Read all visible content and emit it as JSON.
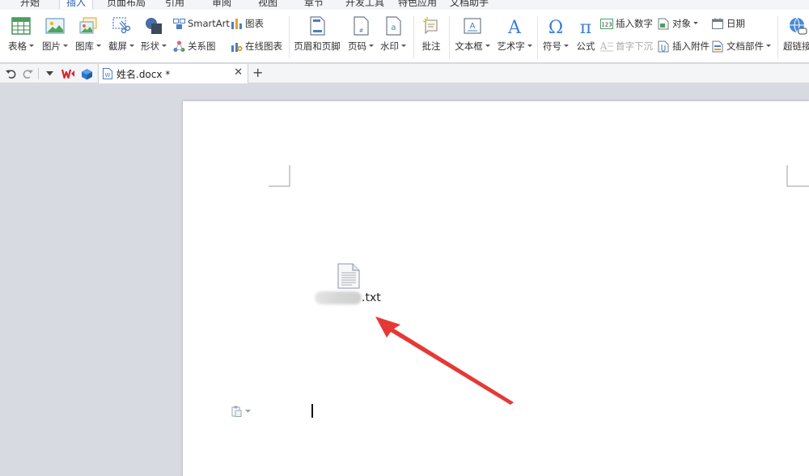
{
  "menu_tabs": [
    {
      "label": "开始",
      "active": false
    },
    {
      "label": "插入",
      "active": true
    },
    {
      "label": "页面布局",
      "active": false
    },
    {
      "label": "引用",
      "active": false
    },
    {
      "label": "审阅",
      "active": false
    },
    {
      "label": "视图",
      "active": false
    },
    {
      "label": "章节",
      "active": false
    },
    {
      "label": "开发工具",
      "active": false
    },
    {
      "label": "特色应用",
      "active": false
    },
    {
      "label": "文档助手",
      "active": false
    }
  ],
  "ribbon": {
    "table": "表格",
    "picture": "图片",
    "gallery": "图库",
    "screenshot": "截屏",
    "shape": "形状",
    "smartart": "SmartArt",
    "relation": "关系图",
    "chart": "图表",
    "online_chart": "在线图表",
    "header_footer": "页眉和页脚",
    "page_number": "页码",
    "watermark": "水印",
    "comment": "批注",
    "textbox": "文本框",
    "wordart": "艺术字",
    "symbol": "符号",
    "formula": "公式",
    "insert_number": "插入数字",
    "dropcap": "首字下沉",
    "object": "对象",
    "attachment": "插入附件",
    "date": "日期",
    "doc_parts": "文档部件",
    "hyperlink": "超链接"
  },
  "document_tab": {
    "name": "姓名.docx *"
  },
  "document": {
    "attachment_ext": ".txt"
  },
  "colors": {
    "accent": "#2b5fb8",
    "arrow": "#e53935",
    "wps_red": "#d8262c"
  }
}
